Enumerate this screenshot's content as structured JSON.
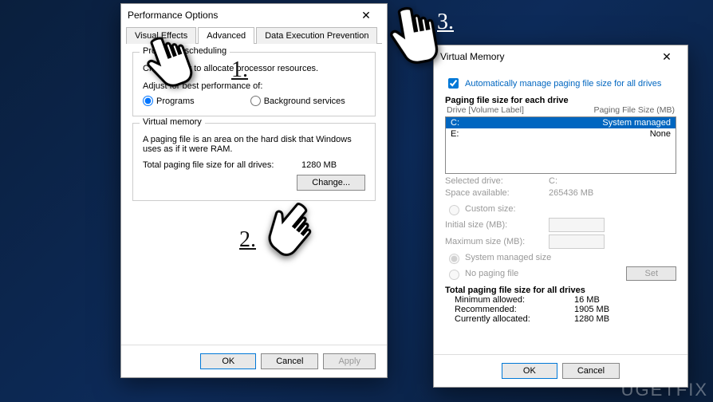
{
  "perf": {
    "title": "Performance Options",
    "tabs": {
      "visual": "Visual Effects",
      "advanced": "Advanced",
      "dep": "Data Execution Prevention"
    },
    "proc": {
      "group": "Processor scheduling",
      "desc": "Choose how to allocate processor resources.",
      "adjust": "Adjust for best performance of:",
      "programs": "Programs",
      "bg": "Background services"
    },
    "vm": {
      "group": "Virtual memory",
      "desc": "A paging file is an area on the hard disk that Windows uses as if it were RAM.",
      "total_label": "Total paging file size for all drives:",
      "total_value": "1280 MB",
      "change": "Change..."
    },
    "ok": "OK",
    "cancel": "Cancel",
    "apply": "Apply"
  },
  "vmDialog": {
    "title": "Virtual Memory",
    "auto": "Automatically manage paging file size for all drives",
    "pfs_group": "Paging file size for each drive",
    "drive_col": "Drive  [Volume Label]",
    "size_col": "Paging File Size (MB)",
    "drives": [
      {
        "label": "C:",
        "value": "System managed",
        "selected": true
      },
      {
        "label": "E:",
        "value": "None",
        "selected": false
      }
    ],
    "selected_drive_label": "Selected drive:",
    "selected_drive_value": "C:",
    "space_label": "Space available:",
    "space_value": "265436 MB",
    "custom": "Custom size:",
    "initial": "Initial size (MB):",
    "maximum": "Maximum size (MB):",
    "sys_managed": "System managed size",
    "no_paging": "No paging file",
    "set": "Set",
    "total_header": "Total paging file size for all drives",
    "min_label": "Minimum allowed:",
    "min_value": "16 MB",
    "rec_label": "Recommended:",
    "rec_value": "1905 MB",
    "cur_label": "Currently allocated:",
    "cur_value": "1280 MB",
    "ok": "OK",
    "cancel": "Cancel"
  },
  "steps": {
    "s1": "1.",
    "s2": "2.",
    "s3": "3."
  },
  "watermark": "UGETFIX"
}
